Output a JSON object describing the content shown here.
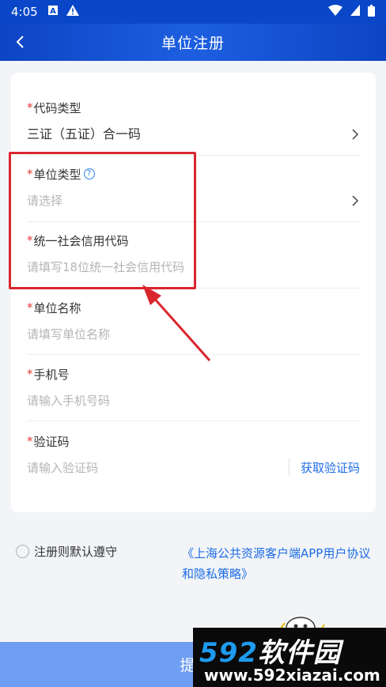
{
  "statusbar": {
    "time": "4:05",
    "icons": [
      "a-box-icon",
      "warning-icon",
      "wifi-icon",
      "signal-icon",
      "battery-icon"
    ]
  },
  "appbar": {
    "title": "单位注册",
    "back_icon": "chevron-left-icon"
  },
  "form": {
    "required_mark": "*",
    "code_type": {
      "label": "代码类型",
      "value": "三证（五证）合一码"
    },
    "unit_type": {
      "label": "单位类型",
      "placeholder": "请选择",
      "help_icon": "?"
    },
    "credit_code": {
      "label": "统一社会信用代码",
      "placeholder": "请填写18位统一社会信用代码"
    },
    "unit_name": {
      "label": "单位名称",
      "placeholder": "请填写单位名称"
    },
    "phone": {
      "label": "手机号",
      "placeholder": "请输入手机号码"
    },
    "verify_code": {
      "label": "验证码",
      "placeholder": "请输入验证码",
      "button": "获取验证码"
    }
  },
  "agreement": {
    "text": "注册则默认遵守",
    "link_line1": "《上海公共资源客户端APP用户协议",
    "link_line2": "和隐私策略》"
  },
  "submit": {
    "label": "提"
  },
  "watermark": {
    "brand_num": "592",
    "brand_text": "软件园",
    "url": "www.592xiazai.com"
  },
  "colors": {
    "primary": "#0a47c8",
    "link": "#1e6de6",
    "required": "#e53935",
    "annotation": "#d9262e",
    "submit_bg": "#6f9ef2"
  }
}
